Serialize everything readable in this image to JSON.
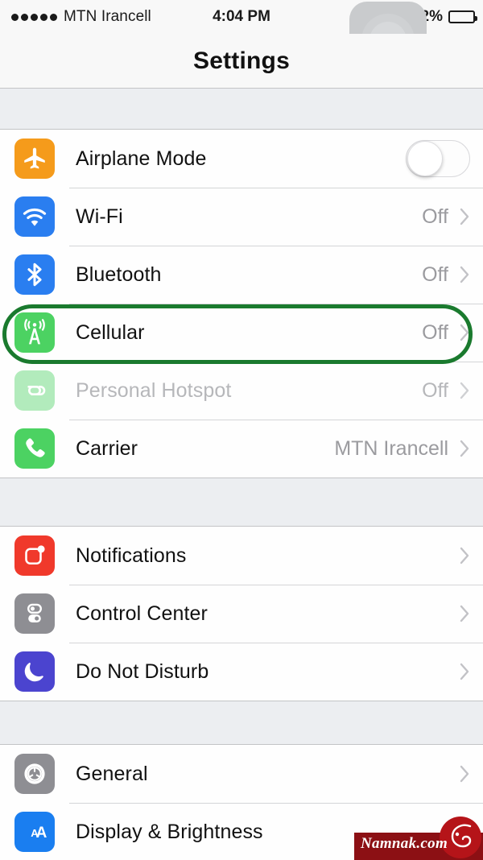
{
  "status_bar": {
    "signal_dots": 5,
    "carrier": "MTN Irancell",
    "time": "4:04 PM",
    "battery_percent": "42%",
    "battery_level": 42,
    "orientation_lock_icon": "rotation-lock-icon"
  },
  "assistive_touch": {
    "name": "assistive-touch-button"
  },
  "navbar": {
    "title": "Settings"
  },
  "colors": {
    "airplane": "#f59b1b",
    "wifi": "#2a7ef0",
    "bluetooth": "#2a7ef0",
    "cellular": "#4cd262",
    "hotspot": "#4cd262",
    "carrier": "#4cd262",
    "notifications": "#f0392b",
    "control_center": "#8e8e93",
    "do_not_disturb": "#4b44cf",
    "general": "#8e8e93",
    "display": "#1a7ef0",
    "highlight_ring": "#1a7a2e",
    "watermark_band": "#8c1014"
  },
  "sections": [
    {
      "rows": [
        {
          "label": "Airplane Mode",
          "icon": "airplane-icon",
          "icon_color": "#f59b1b",
          "control": "toggle",
          "toggle_on": false
        },
        {
          "label": "Wi-Fi",
          "icon": "wifi-icon",
          "icon_color": "#2a7ef0",
          "control": "chevron",
          "value": "Off"
        },
        {
          "label": "Bluetooth",
          "icon": "bluetooth-icon",
          "icon_color": "#2a7ef0",
          "control": "chevron",
          "value": "Off"
        },
        {
          "label": "Cellular",
          "icon": "cellular-icon",
          "icon_color": "#4cd262",
          "control": "chevron",
          "value": "Off",
          "highlighted": true
        },
        {
          "label": "Personal Hotspot",
          "icon": "personal-hotspot-icon",
          "icon_color": "#4cd262",
          "control": "chevron",
          "value": "Off",
          "disabled": true
        },
        {
          "label": "Carrier",
          "icon": "phone-icon",
          "icon_color": "#4cd262",
          "control": "chevron",
          "value": "MTN Irancell"
        }
      ]
    },
    {
      "rows": [
        {
          "label": "Notifications",
          "icon": "notifications-icon",
          "icon_color": "#f0392b",
          "control": "chevron",
          "value": ""
        },
        {
          "label": "Control Center",
          "icon": "control-center-icon",
          "icon_color": "#8e8e93",
          "control": "chevron",
          "value": ""
        },
        {
          "label": "Do Not Disturb",
          "icon": "moon-icon",
          "icon_color": "#4b44cf",
          "control": "chevron",
          "value": ""
        }
      ]
    },
    {
      "rows": [
        {
          "label": "General",
          "icon": "gear-icon",
          "icon_color": "#8e8e93",
          "control": "chevron",
          "value": ""
        },
        {
          "label": "Display & Brightness",
          "icon": "display-brightness-icon",
          "icon_color": "#1a7ef0",
          "control": "chevron",
          "value": ""
        }
      ]
    }
  ],
  "watermark": {
    "text": "Namnak.com"
  }
}
